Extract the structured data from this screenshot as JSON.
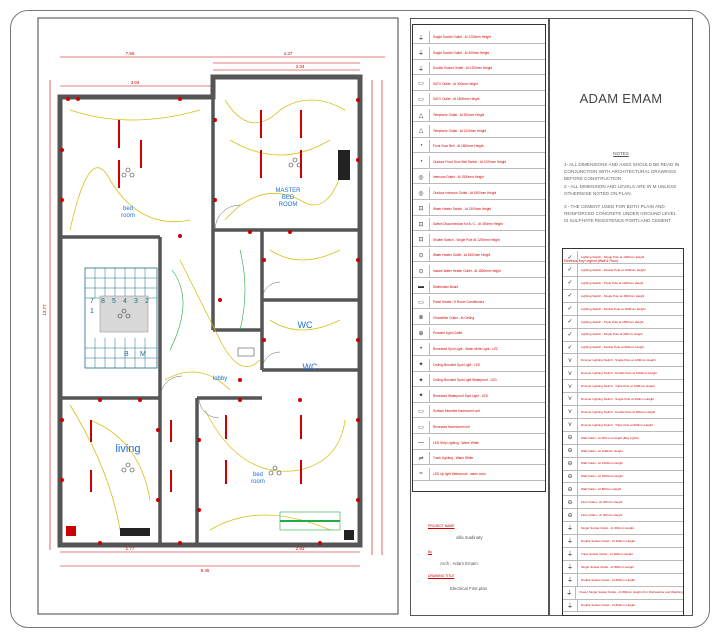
{
  "author": "ADAM EMAM",
  "notes": {
    "title": "NOTES",
    "items": [
      "1- ALL DIMENSIONS AND AXES SHOULD BE READ IN CONJUNCTION WITH ARCHITECTURAL DRAWINGS BEFORE CONSTRUCTION",
      "2 - ALL DIMENSION AND LEVELS ARE IN M UNLESS OTHERWISE NOTED ON PLAN.",
      "3 - THE CEMENT USED FOR BOTH PLAIN AND REINFORCED CONCRETE UNDER GROUND LEVEL IS SULPHATE RESISTENCE PORTLAND CEMENT."
    ]
  },
  "legend_title": "Electrical Key Legend (Wall & Floor)",
  "project": {
    "name_label": "PROJECT NAME",
    "name": "villa madinaty",
    "by_label": "By",
    "by": "Arch : Adam Emam",
    "drawing_label": "DRAWING TITLE",
    "drawing": "Electrical First plan"
  },
  "rooms": {
    "master": [
      "MASTER",
      "BED",
      "ROOM"
    ],
    "bed1": [
      "bed",
      "room"
    ],
    "bed2": [
      "bed",
      "room"
    ],
    "wc1": "WC",
    "wc2": "WC",
    "living": "living",
    "lobby": "lobby"
  },
  "dimensions": {
    "top_total": "7.55",
    "top_right": "4.37",
    "top_a": "3.04",
    "top_b": "3.34",
    "bottom_total": "8.45",
    "bottom_a": "1.77",
    "bottom_b": "2.93",
    "left_total": "13.77"
  },
  "stair_numbers": [
    "7",
    "8",
    "5",
    "4",
    "3",
    "2",
    "1",
    "B",
    "M"
  ],
  "legend_left": [
    "Single Socket Outlet - At 1200mm Height",
    "Single Socket Outlet - At 300mm Height",
    "Double Socket Outlet - At 1200mm Height",
    "SATV Outlet - At 300mm Height",
    "SATV Outlet - At 1800mm Height",
    "Telephone Outlet - At 300mm Height",
    "Telephone Outlet - At 1200mm Height",
    "Front Door Bell - At 1800mm Height",
    "Outdoor Front Door Bell Switch - At 1200mm Height",
    "Intercom Outlet - At 1500mm Height",
    "Outdoor Intercom Outlet - At 1500mm Height",
    "Water Heater Switch - At 1300mm Height",
    "Switch Disconnection for A / C - At 300mm Height",
    "Shutter Switch - Single Pole At 1200mm Height",
    "Water Heater Outlet - At 1800mm Height",
    "Instant Water Heater Outlet - At 1800mm Height",
    "Distribution Board",
    "Panel Heater / 6 Room Conditioners",
    "Chandelier Outlet - At Ceiling",
    "Pendant Light Outlet",
    "Recessed Spot Light - Wash white Light - LED",
    "Ceiling Mounted Spot Light - LED",
    "Ceiling Mounted Spot Light Waterproof - LED",
    "Recessed Waterproof Spot Light - LED",
    "Surface Mounted fluorescent unit",
    "Recessed fluorescent unit",
    "LED Strip Lighting - Warm White",
    "Track Lighting - Warm White",
    "LED Up light Waterproof - warm color"
  ],
  "legend_right": [
    "Lighting Switch - Single Pole at 1200mm Height",
    "Lighting Switch - Double Pole at 1200mm Height",
    "Lighting Switch - Triple Pole at 1200mm Height",
    "Lighting Switch - Single Pole at 1500mm Height",
    "Lighting Switch - Double Pole at 1500mm Height",
    "Lighting Switch - Triple Pole at 1500mm Height",
    "Lighting Switch - Single Pole at 900mm Height",
    "Lighting Switch - Double Pole at 900mm Height",
    "Dimmer Lighting Switch - Single Pole at 1200mm Height",
    "Dimmer Lighting Switch - Double Pole at 1200mm Height",
    "Dimmer Lighting Switch - Triple Pole at 1200mm Height",
    "Dimmer Lighting Switch - Single Pole at 900mm Height",
    "Dimmer Lighting Switch - Double Pole at 900mm Height",
    "Dimmer Lighting Switch - Triple Pole at 900mm Height",
    "Wall Outlet - At 300 mm Height (Bay Lights)",
    "Wall Outlet - At 1100mm Height",
    "Wall Outlet - At 1300mm Height",
    "Wall Outlet - At 1800mm Height",
    "Wall Outlet - At 800mm Height",
    "Floor Outlet - At 300mm Height",
    "Floor Outlet - At 300mm Height",
    "Single Socket Outlet - At 300mm Height",
    "Double Socket Outlet - At 300mm Height",
    "Triple Socket Outlet - At 300mm Height",
    "Single Socket Outlet - At 800mm Height",
    "Double Socket Outlet - At 800mm Height",
    "Power Single Socket Outlet - At 800mm Height (For Dishwasher and Washing Machine)",
    "Double Socket Outlet - At 800mm Height"
  ]
}
